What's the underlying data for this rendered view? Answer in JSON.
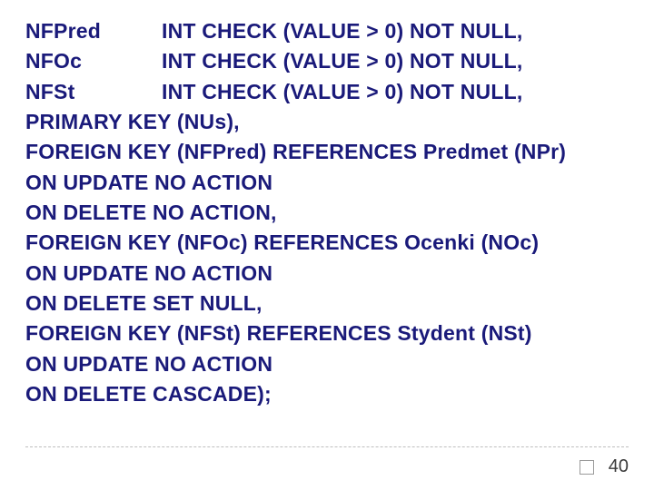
{
  "columns": [
    {
      "name": "NFPred",
      "type": "INT CHECK (VALUE > 0) NOT NULL,"
    },
    {
      "name": "NFOc",
      "type": "INT CHECK (VALUE > 0) NOT NULL,"
    },
    {
      "name": "NFSt",
      "type": "INT CHECK (VALUE > 0) NOT NULL,"
    }
  ],
  "lines": [
    "PRIMARY KEY (NUs),",
    "FOREIGN KEY (NFPred) REFERENCES Predmet (NPr)",
    "ON UPDATE NO ACTION",
    "ON DELETE NO ACTION,",
    "FOREIGN KEY (NFOc) REFERENCES Ocenki (NOc)",
    "ON UPDATE NO ACTION",
    "ON DELETE SET NULL,",
    "FOREIGN KEY (NFSt) REFERENCES Stydent (NSt)",
    "ON UPDATE NO ACTION",
    "ON DELETE CASCADE);"
  ],
  "page_number": "40"
}
